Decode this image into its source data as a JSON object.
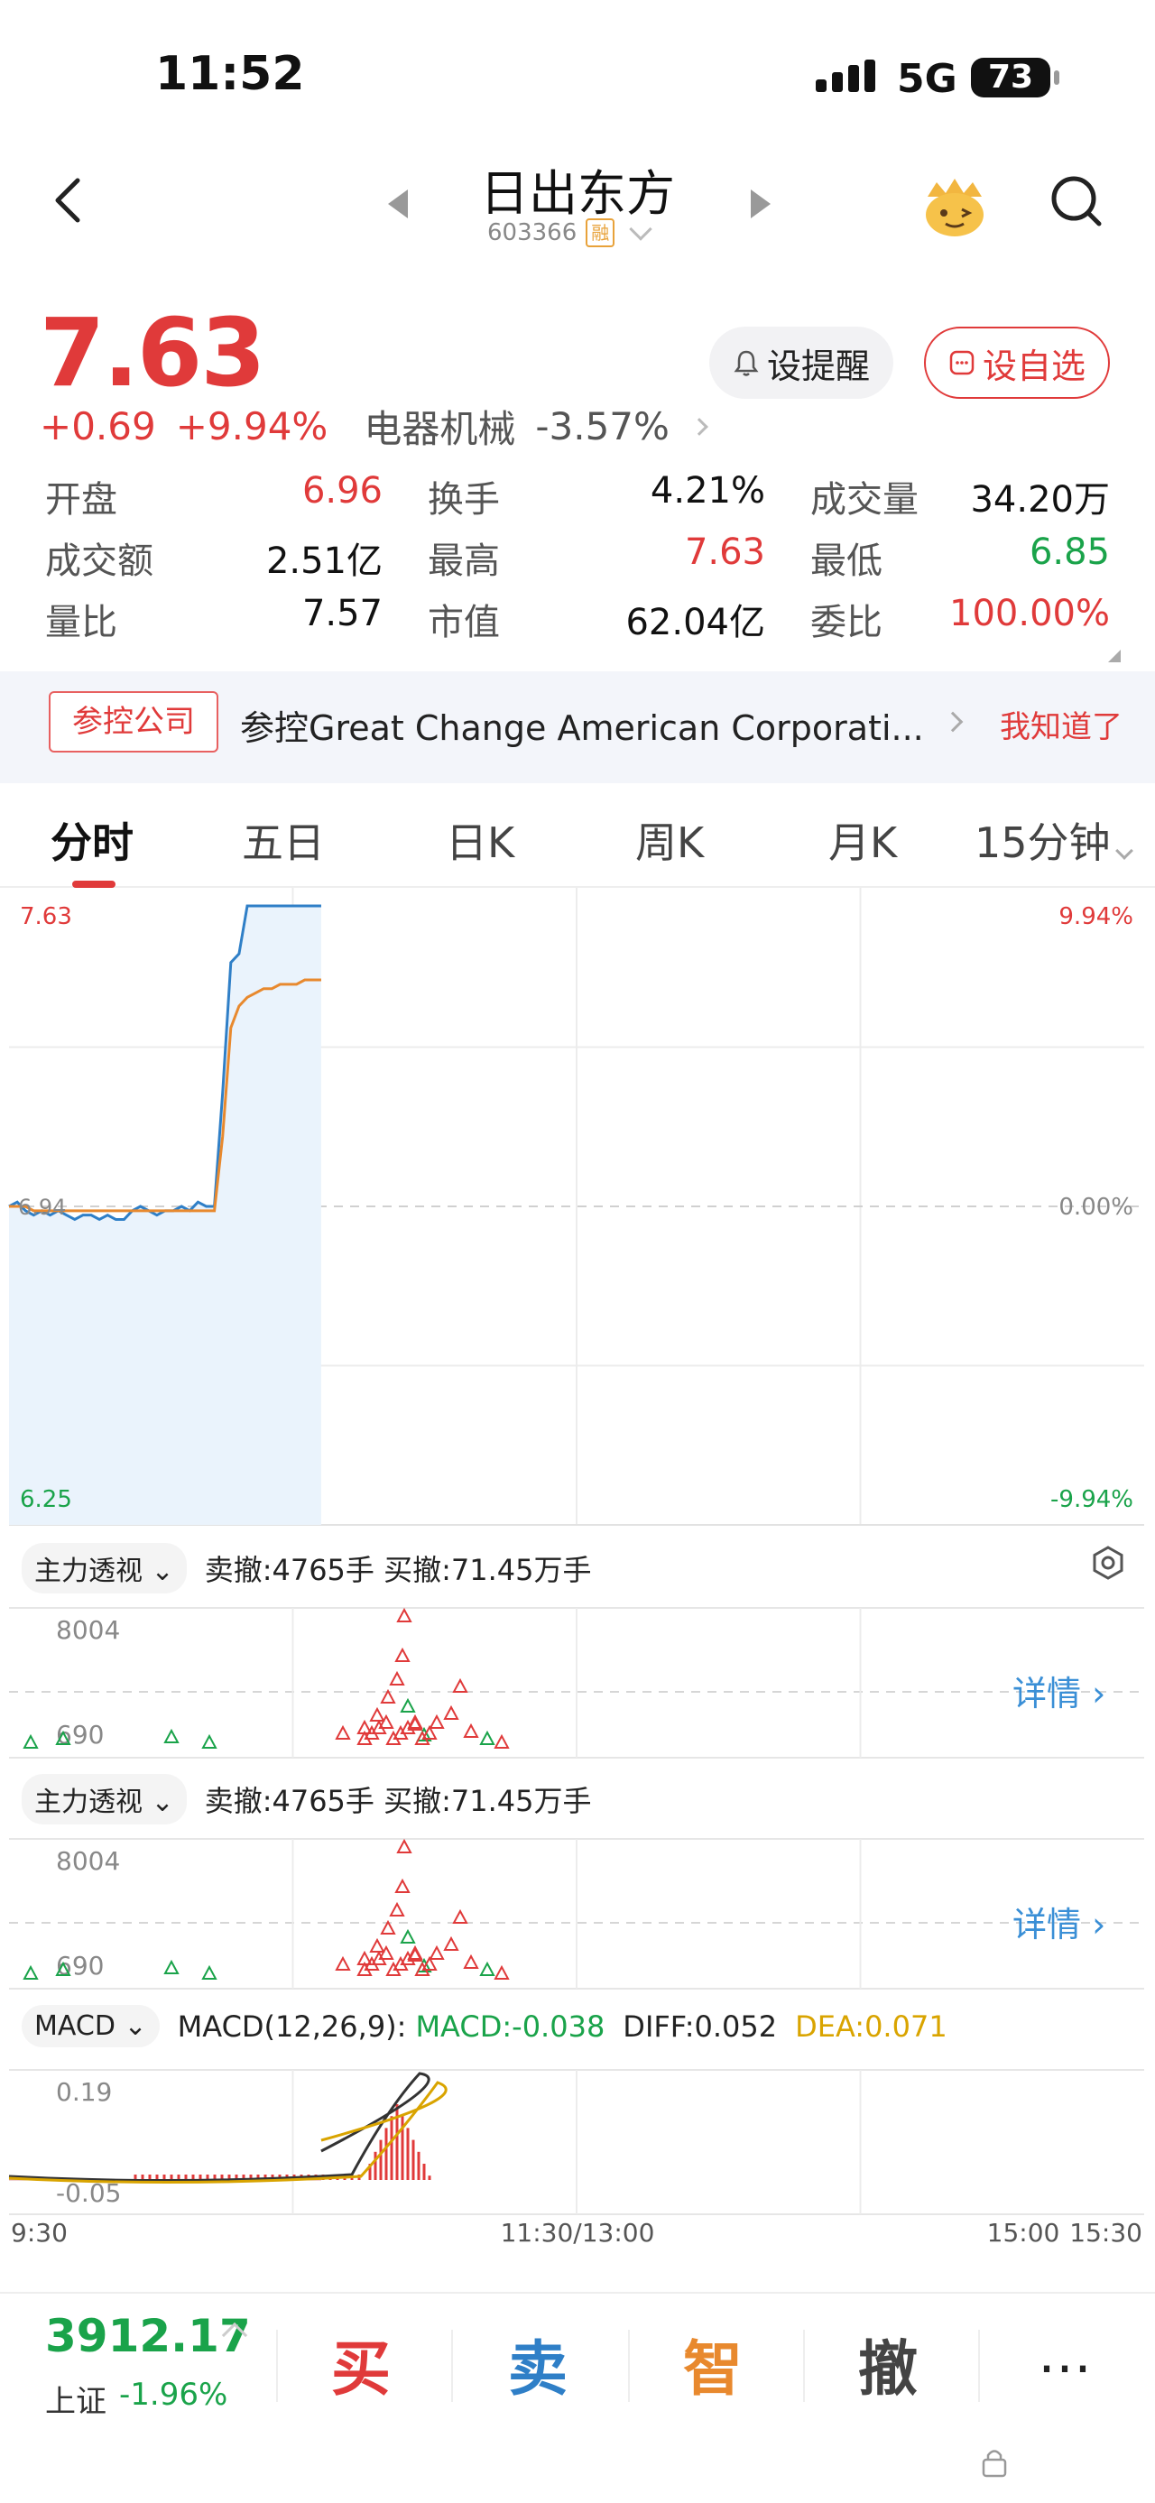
{
  "status_bar": {
    "time": "11:52",
    "network": "5G",
    "battery": "73"
  },
  "header": {
    "stock_name": "日出东方",
    "stock_code": "603366",
    "margin_badge": "融"
  },
  "quote": {
    "price": "7.63",
    "change": "+0.69",
    "change_pct": "+9.94%",
    "sector_name": "电器机械",
    "sector_change": "-3.57%",
    "alert_button": "设提醒",
    "favorite_button": "设自选",
    "stats": [
      [
        {
          "label": "开盘",
          "value": "6.96",
          "color": "red"
        },
        {
          "label": "换手",
          "value": "4.21%",
          "color": ""
        },
        {
          "label": "成交量",
          "value": "34.20万",
          "color": ""
        }
      ],
      [
        {
          "label": "成交额",
          "value": "2.51亿",
          "color": ""
        },
        {
          "label": "最高",
          "value": "7.63",
          "color": "red"
        },
        {
          "label": "最低",
          "value": "6.85",
          "color": "green"
        }
      ],
      [
        {
          "label": "量比",
          "value": "7.57",
          "color": ""
        },
        {
          "label": "市值",
          "value": "62.04亿",
          "color": ""
        },
        {
          "label": "委比",
          "value": "100.00%",
          "color": "red"
        }
      ]
    ]
  },
  "banner": {
    "tag": "参控公司",
    "message": "参控Great Change American Corporati...",
    "dismiss": "我知道了"
  },
  "tabs": [
    "分时",
    "五日",
    "日K",
    "周K",
    "月K",
    "15分钟"
  ],
  "chart_data": {
    "type": "line",
    "title": "",
    "y_labels": {
      "top_price": "7.63",
      "bottom_price": "6.25",
      "top_pct": "9.94%",
      "mid_pct": "0.00%",
      "bottom_pct": "-9.94%",
      "mid_price": "6.94"
    },
    "ylim": [
      6.25,
      7.63
    ],
    "x_labels": [
      "9:30",
      "11:30/13:00",
      "15:00",
      "15:30"
    ],
    "series": [
      {
        "name": "",
        "color": "#2f7fc7",
        "values": [
          6.94,
          6.95,
          6.93,
          6.92,
          6.93,
          6.92,
          6.93,
          6.92,
          6.91,
          6.92,
          6.92,
          6.91,
          6.92,
          6.91,
          6.91,
          6.93,
          6.94,
          6.93,
          6.92,
          6.93,
          6.93,
          6.94,
          6.93,
          6.95,
          6.94,
          6.94,
          7.2,
          7.5,
          7.52,
          7.63,
          7.63,
          7.63,
          7.63,
          7.63,
          7.63,
          7.63,
          7.63,
          7.63,
          7.63
        ]
      },
      {
        "name": "",
        "color": "#e8892e",
        "values": [
          6.94,
          6.94,
          6.94,
          6.93,
          6.93,
          6.93,
          6.93,
          6.93,
          6.93,
          6.93,
          6.93,
          6.93,
          6.93,
          6.93,
          6.93,
          6.93,
          6.93,
          6.93,
          6.93,
          6.93,
          6.93,
          6.93,
          6.93,
          6.93,
          6.93,
          6.93,
          7.1,
          7.35,
          7.4,
          7.42,
          7.43,
          7.44,
          7.44,
          7.45,
          7.45,
          7.45,
          7.46,
          7.46,
          7.46
        ]
      }
    ]
  },
  "flow_panels": [
    {
      "name": "主力透视",
      "summary": "卖撤:4765手 买撤:71.45万手",
      "max": "8004",
      "min": "690",
      "detail": "详情"
    },
    {
      "name": "主力透视",
      "summary": "卖撤:4765手 买撤:71.45万手",
      "max": "8004",
      "min": "690",
      "detail": "详情"
    }
  ],
  "macd": {
    "name": "MACD",
    "params": "MACD(12,26,9):",
    "macd_value": "MACD:-0.038",
    "diff_value": "DIFF:0.052",
    "dea_value": "DEA:0.071",
    "max": "0.19",
    "min": "-0.05"
  },
  "bottom_bar": {
    "index_value": "3912.17",
    "index_name": "上证",
    "index_change": "-1.96%",
    "buy": "买",
    "sell": "卖",
    "smart": "智",
    "cancel": "撤",
    "more": "⋯"
  },
  "colors": {
    "up": "#e03a3a",
    "down": "#1aa34a",
    "accent_blue": "#3a8fd6",
    "smart": "#e8892e"
  }
}
